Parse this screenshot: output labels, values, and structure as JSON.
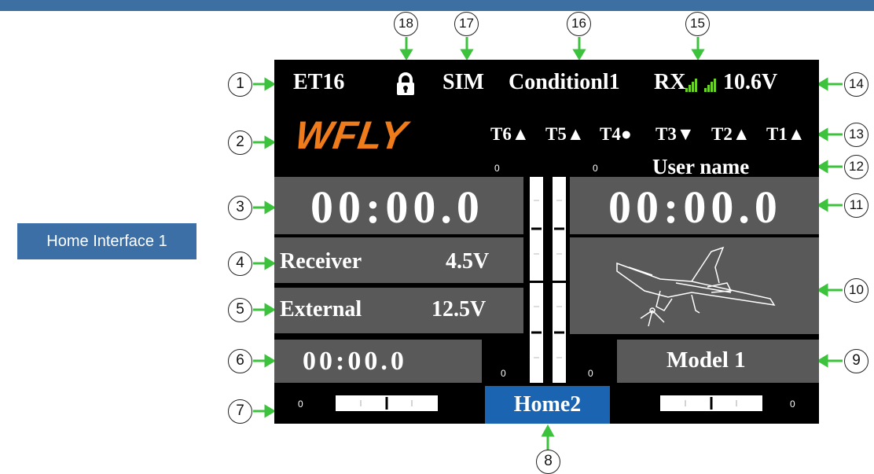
{
  "header_label": "Home Interface 1",
  "status": {
    "model_name": "ET16",
    "mode": "SIM",
    "condition": "Conditionl1",
    "rx": "RX",
    "voltage": "10.6V"
  },
  "brand": "WFLY",
  "trims": [
    "T6▲",
    "T5▲",
    "T4●",
    "T3▼",
    "T2▲",
    "T1▲"
  ],
  "user_name": "User name",
  "timers": {
    "left": "00:00.0",
    "right": "00:00.0",
    "model_timer": "00:00.0"
  },
  "receiver": {
    "label": "Receiver",
    "value": "4.5V"
  },
  "external": {
    "label": "External",
    "value": "12.5V"
  },
  "model": "Model 1",
  "home_button": "Home2",
  "zeros": {
    "vbar_top_left": "0",
    "vbar_top_right": "0",
    "vbar_bottom_left": "0",
    "vbar_bottom_right": "0",
    "hbar_left": "0",
    "hbar_right": "0"
  },
  "callouts": [
    "1",
    "2",
    "3",
    "4",
    "5",
    "6",
    "7",
    "8",
    "9",
    "10",
    "11",
    "12",
    "13",
    "14",
    "15",
    "16",
    "17",
    "18"
  ],
  "colors": {
    "accent_blue": "#1a64b2",
    "brand_orange": "#f07b1a",
    "signal_green": "#6ad22a",
    "arrow_green": "#3cc23c",
    "panel_gray": "#595959"
  },
  "icons": {
    "lock": "lock-icon",
    "airplane": "airplane-icon",
    "signal": "signal-bars-icon"
  }
}
